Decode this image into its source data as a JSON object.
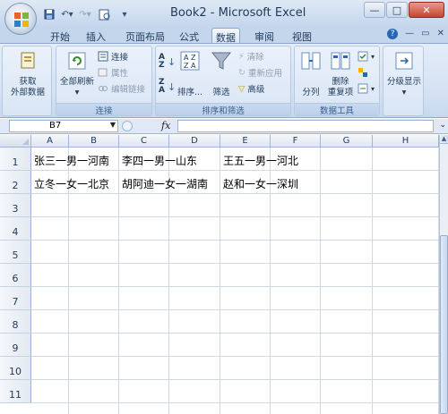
{
  "window": {
    "title": "Book2 - Microsoft Excel",
    "minimize": "—",
    "maximize": "□",
    "close": "✕"
  },
  "qat": [
    "save-icon",
    "undo-icon",
    "redo-icon",
    "print-preview-icon"
  ],
  "tabs": [
    "开始",
    "插入",
    "页面布局",
    "公式",
    "数据",
    "审阅",
    "视图"
  ],
  "active_tab": "数据",
  "ribbon": {
    "get_external": {
      "label_line1": "获取",
      "label_line2": "外部数据"
    },
    "connections": {
      "refresh_all": "全部刷新",
      "connections": "连接",
      "properties": "属性",
      "edit_links": "编辑链接",
      "group_label": "连接"
    },
    "sort_filter": {
      "sort": "排序...",
      "filter": "筛选",
      "clear": "清除",
      "reapply": "重新应用",
      "advanced": "高级",
      "group_label": "排序和筛选"
    },
    "data_tools": {
      "split": "分列",
      "remove_dup_line1": "删除",
      "remove_dup_line2": "重复项",
      "group_label": "数据工具"
    },
    "outline": {
      "label": "分级显示"
    }
  },
  "formula_bar": {
    "name_box": "B7",
    "fx": "fx",
    "formula": ""
  },
  "sheet": {
    "columns": [
      "A",
      "B",
      "C",
      "D",
      "E",
      "F",
      "G",
      "H"
    ],
    "rows": [
      "1",
      "2",
      "3",
      "4",
      "5",
      "6",
      "7",
      "8",
      "9",
      "10",
      "11"
    ],
    "cells": {
      "A1": "张三一男一河南",
      "C1": "李四一男一山东",
      "E1": "王五一男一河北",
      "A2": "立冬一女一北京",
      "C2": "胡阿迪一女一湖南",
      "E2": "赵和一女一深圳"
    }
  },
  "colors": {
    "accent": "#c4d6ec",
    "header_text": "#1e395b",
    "gridline": "#d0d7e5"
  }
}
